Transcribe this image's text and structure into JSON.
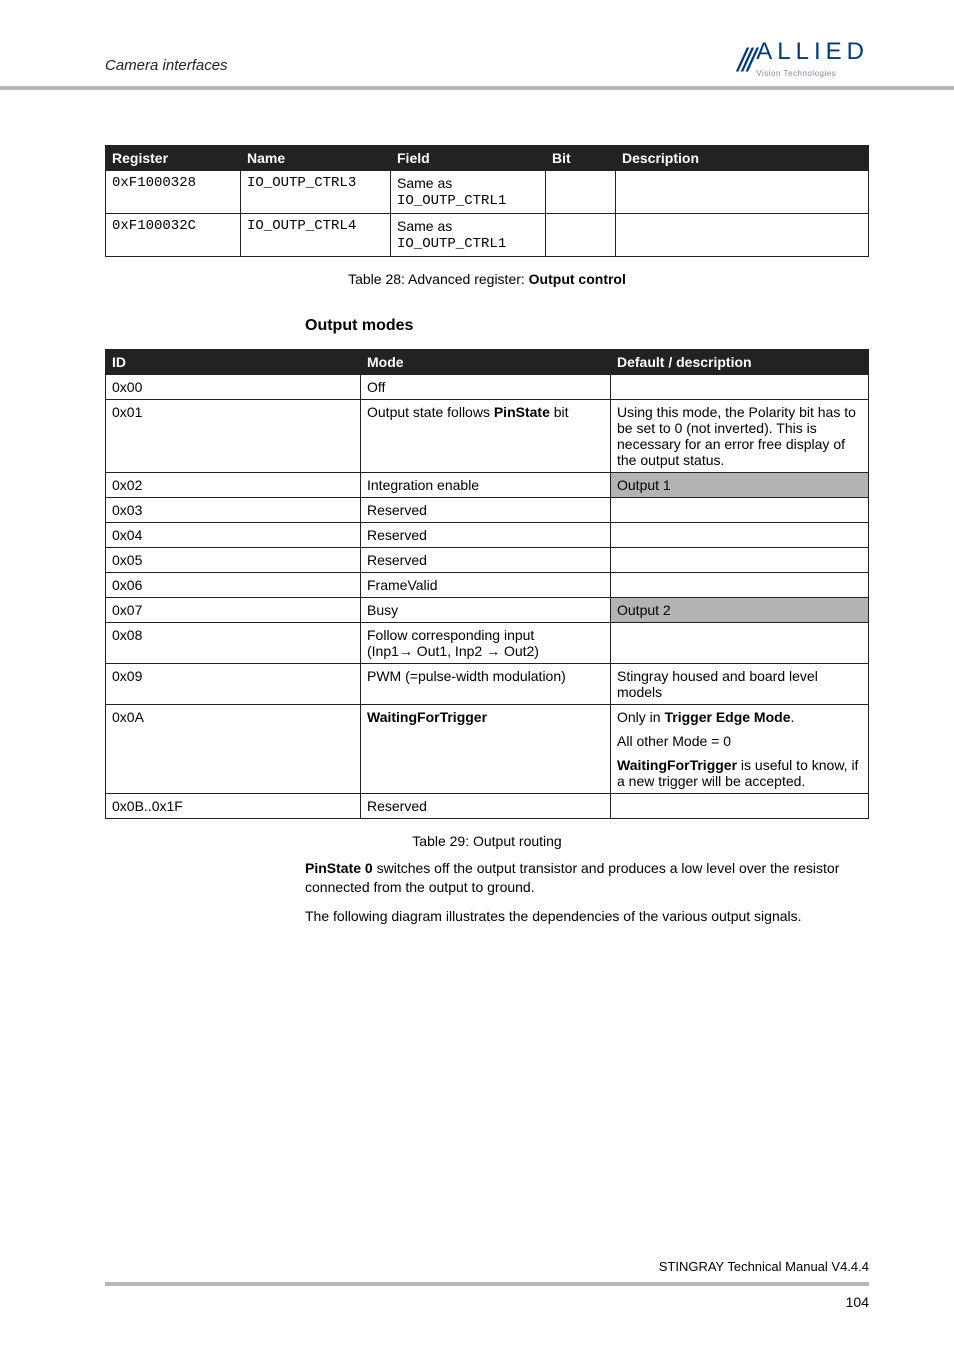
{
  "header": {
    "section": "Camera interfaces",
    "logo_main": "ALLIED",
    "logo_sub": "Vision Technologies"
  },
  "table1": {
    "headers": [
      "Register",
      "Name",
      "Field",
      "Bit",
      "Description"
    ],
    "rows": [
      {
        "register": "0xF1000328",
        "name": "IO_OUTP_CTRL3",
        "field_a": "Same as",
        "field_b": "IO_OUTP_CTRL1",
        "bit": "",
        "desc": ""
      },
      {
        "register": "0xF100032C",
        "name": "IO_OUTP_CTRL4",
        "field_a": "Same as",
        "field_b": "IO_OUTP_CTRL1",
        "bit": "",
        "desc": ""
      }
    ],
    "caption_a": "Table 28: Advanced register: ",
    "caption_b": "Output control"
  },
  "section_heading": "Output modes",
  "table2": {
    "headers": [
      "ID",
      "Mode",
      "Default / description"
    ],
    "rows": [
      {
        "id": "0x00",
        "mode": "Off",
        "desc": ""
      },
      {
        "id": "0x01",
        "mode_a": "Output state follows ",
        "mode_b": "PinState",
        "mode_c": " bit",
        "desc": "Using this mode, the Polarity bit has to be set to 0 (not inverted). This is necessary for an error free display of the output status."
      },
      {
        "id": "0x02",
        "mode": "Integration enable",
        "desc": "Output 1",
        "shade": true
      },
      {
        "id": "0x03",
        "mode": "Reserved",
        "desc": ""
      },
      {
        "id": "0x04",
        "mode": "Reserved",
        "desc": ""
      },
      {
        "id": "0x05",
        "mode": "Reserved",
        "desc": ""
      },
      {
        "id": "0x06",
        "mode": "FrameValid",
        "desc": ""
      },
      {
        "id": "0x07",
        "mode": "Busy",
        "desc": "Output 2",
        "shade": true
      },
      {
        "id": "0x08",
        "mode_a": "Follow corresponding input",
        "mode_b": "(Inp1→ Out1, Inp2 → Out2)",
        "desc": ""
      },
      {
        "id": "0x09",
        "mode": "PWM (=pulse-width modulation)",
        "desc": "Stingray housed and board level models"
      },
      {
        "id": "0x0A",
        "mode": "WaitingForTrigger",
        "d1a": "Only in ",
        "d1b": "Trigger Edge Mode",
        "d1c": ".",
        "d2": "All other Mode = 0",
        "d3a": "WaitingForTrigger",
        "d3b": " is useful to know, if a new trigger will be accepted."
      },
      {
        "id": "0x0B..0x1F",
        "mode": "Reserved",
        "desc": ""
      }
    ],
    "caption": "Table 29: Output routing"
  },
  "paragraphs": {
    "p1a": "PinState 0",
    "p1b": " switches off the output transistor and produces a low level over the resistor connected from the output to ground.",
    "p2": "The following diagram illustrates the dependencies of the various output signals."
  },
  "footer": {
    "manual": "STINGRAY Technical Manual V4.4.4",
    "page": "104"
  }
}
